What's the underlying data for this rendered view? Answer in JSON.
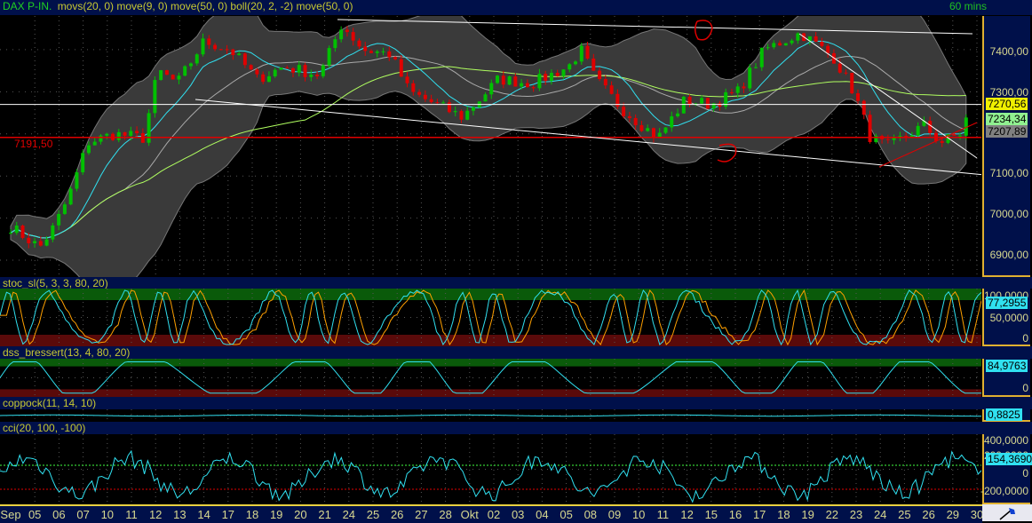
{
  "header": {
    "symbol": "DAX P-IN.",
    "indicators": "movs(20, 0) move(9, 0) move(50, 0) boll(20, 2, -2) move(50, 0)",
    "interval": "60 mins"
  },
  "price_axis": {
    "ticks": [
      "7400,00",
      "7300,00",
      "7100,00",
      "7000,00",
      "6900,00"
    ],
    "last": "7270,56",
    "ma_tag": "7234,34",
    "ma2_tag": "7207,89",
    "hline_label": "7191,50"
  },
  "stoch": {
    "title": "stoc_sl(5, 3, 3, 80, 20)",
    "ticks": [
      "100,0000",
      "50,0000",
      "0"
    ],
    "tag": "77,2955"
  },
  "dss": {
    "title": "dss_bressert(13, 4, 80, 20)",
    "ticks": [
      "0"
    ],
    "tag": "84,9763"
  },
  "coppock": {
    "title": "coppock(11, 14, 10)",
    "tag": "0,8825"
  },
  "cci": {
    "title": "cci(20, 100, -100)",
    "ticks": [
      "400,0000",
      "200,0000",
      "0",
      "-200,0000"
    ],
    "tag": "154,3690"
  },
  "x_labels": [
    "Sep",
    "05",
    "06",
    "07",
    "10",
    "11",
    "12",
    "13",
    "14",
    "17",
    "18",
    "19",
    "20",
    "21",
    "24",
    "25",
    "26",
    "27",
    "28",
    "Okt",
    "02",
    "03",
    "04",
    "05",
    "08",
    "09",
    "10",
    "11",
    "12",
    "15",
    "16",
    "17",
    "18",
    "19",
    "22",
    "23",
    "24",
    "25",
    "26",
    "29",
    "30"
  ],
  "colors": {
    "up": "#00c000",
    "down": "#e00000",
    "ma_fast": "#30e0f0",
    "ma_slow": "#b0ff60",
    "band": "#3a3a3a"
  },
  "chart_data": {
    "type": "candlestick",
    "title": "DAX P-IN. 60 mins",
    "ylim": [
      6860,
      7480
    ],
    "price_path": [
      [
        0,
        6980
      ],
      [
        1.2,
        6930
      ],
      [
        1.8,
        6980
      ],
      [
        2.4,
        7050
      ],
      [
        3.2,
        7180
      ],
      [
        4.3,
        7200
      ],
      [
        5.5,
        7190
      ],
      [
        6.1,
        7350
      ],
      [
        6.9,
        7320
      ],
      [
        8.0,
        7420
      ],
      [
        9.1,
        7400
      ],
      [
        10.2,
        7330
      ],
      [
        11.3,
        7360
      ],
      [
        12.8,
        7340
      ],
      [
        13.7,
        7460
      ],
      [
        14.6,
        7400
      ],
      [
        15.7,
        7390
      ],
      [
        16.5,
        7300
      ],
      [
        17.6,
        7270
      ],
      [
        18.7,
        7240
      ],
      [
        20.2,
        7330
      ],
      [
        21.6,
        7320
      ],
      [
        23.1,
        7360
      ],
      [
        23.6,
        7400
      ],
      [
        24.2,
        7330
      ],
      [
        25.3,
        7260
      ],
      [
        26.8,
        7190
      ],
      [
        27.9,
        7280
      ],
      [
        29.0,
        7270
      ],
      [
        30.1,
        7300
      ],
      [
        31.2,
        7400
      ],
      [
        32.7,
        7440
      ],
      [
        34.1,
        7380
      ],
      [
        34.9,
        7300
      ],
      [
        35.6,
        7190
      ],
      [
        36.3,
        7170
      ],
      [
        37.8,
        7220
      ],
      [
        38.5,
        7180
      ],
      [
        39.3,
        7200
      ],
      [
        39.8,
        7270
      ]
    ],
    "horizontal_lines": [
      7191.5,
      7270
    ]
  }
}
